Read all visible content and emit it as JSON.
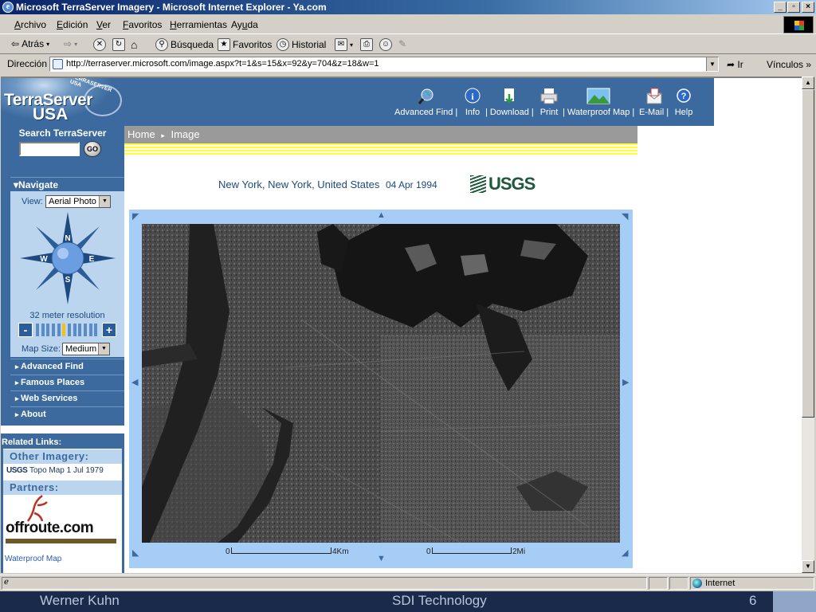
{
  "window": {
    "title": "Microsoft TerraServer Imagery - Microsoft Internet Explorer - Ya.com",
    "minimize": "_",
    "restore": "▫",
    "close": "×"
  },
  "menu": {
    "items": [
      {
        "pre": "",
        "key": "A",
        "rest": "rchivo"
      },
      {
        "pre": "",
        "key": "E",
        "rest": "dición"
      },
      {
        "pre": "",
        "key": "V",
        "rest": "er"
      },
      {
        "pre": "",
        "key": "F",
        "rest": "avoritos"
      },
      {
        "pre": "",
        "key": "H",
        "rest": "erramientas"
      },
      {
        "pre": "Ay",
        "key": "u",
        "rest": "da"
      }
    ]
  },
  "toolbar": {
    "back": "Atrás",
    "search": "Búsqueda",
    "favorites": "Favoritos",
    "history": "Historial"
  },
  "address": {
    "label": "Dirección",
    "url": "http://terraserver.microsoft.com/image.aspx?t=1&s=15&x=92&y=704&z=18&w=1",
    "go": "Ir",
    "links": "Vínculos"
  },
  "status": {
    "zone": "Internet"
  },
  "site": {
    "logo_line1": "TerraServer",
    "logo_line2": "USA",
    "logo_arc": "TERRASERVER USA",
    "nav": [
      {
        "label": "Advanced Find |",
        "icon": "globe-magnifier-icon"
      },
      {
        "label": "Info",
        "icon": "info-icon"
      },
      {
        "label": "| Download |",
        "icon": "download-icon"
      },
      {
        "label": "Print",
        "icon": "printer-icon"
      },
      {
        "label": "| Waterproof Map |",
        "icon": "map-icon"
      },
      {
        "label": "E-Mail |",
        "icon": "email-icon"
      },
      {
        "label": "Help",
        "icon": "help-icon"
      }
    ],
    "search": {
      "label": "Search TerraServer",
      "value": "",
      "go": "GO"
    },
    "navigate": {
      "header": "Navigate",
      "view_label": "View:",
      "view_value": "Aerial Photo",
      "compass": {
        "n": "N",
        "s": "S",
        "e": "E",
        "w": "W"
      },
      "resolution": "32 meter resolution",
      "zoom_minus": "-",
      "zoom_plus": "+",
      "zoom_level_index": 5,
      "zoom_steps": 12,
      "map_size_label": "Map Size:",
      "map_size_value": "Medium"
    },
    "side_links": [
      "Advanced Find",
      "Famous Places",
      "Web Services",
      "About"
    ],
    "related": {
      "title": "Related Links:",
      "other_imagery": "Other Imagery:",
      "usgs_mark": "USGS",
      "topo": "Topo Map 1 Jul 1979",
      "partners": "Partners:",
      "offroute": "offroute.com",
      "waterproof": "Waterproof Map"
    },
    "breadcrumb": {
      "home": "Home",
      "sep": "▸",
      "current": "Image"
    },
    "image": {
      "place": "New York, New York, United States",
      "date": "04 Apr 1994",
      "provider": "USGS"
    },
    "scale": {
      "km_start": "0",
      "km_end": "4Km",
      "mi_start": "0",
      "mi_end": "2Mi"
    }
  },
  "footer": {
    "author": "Werner Kuhn",
    "title": "SDI Technology",
    "page": "6"
  },
  "colors": {
    "site_blue": "#3c6a9e",
    "panel_light": "#bcd5ee",
    "map_frame": "#a6cdf6",
    "footer_bg": "#1a2a4a"
  }
}
